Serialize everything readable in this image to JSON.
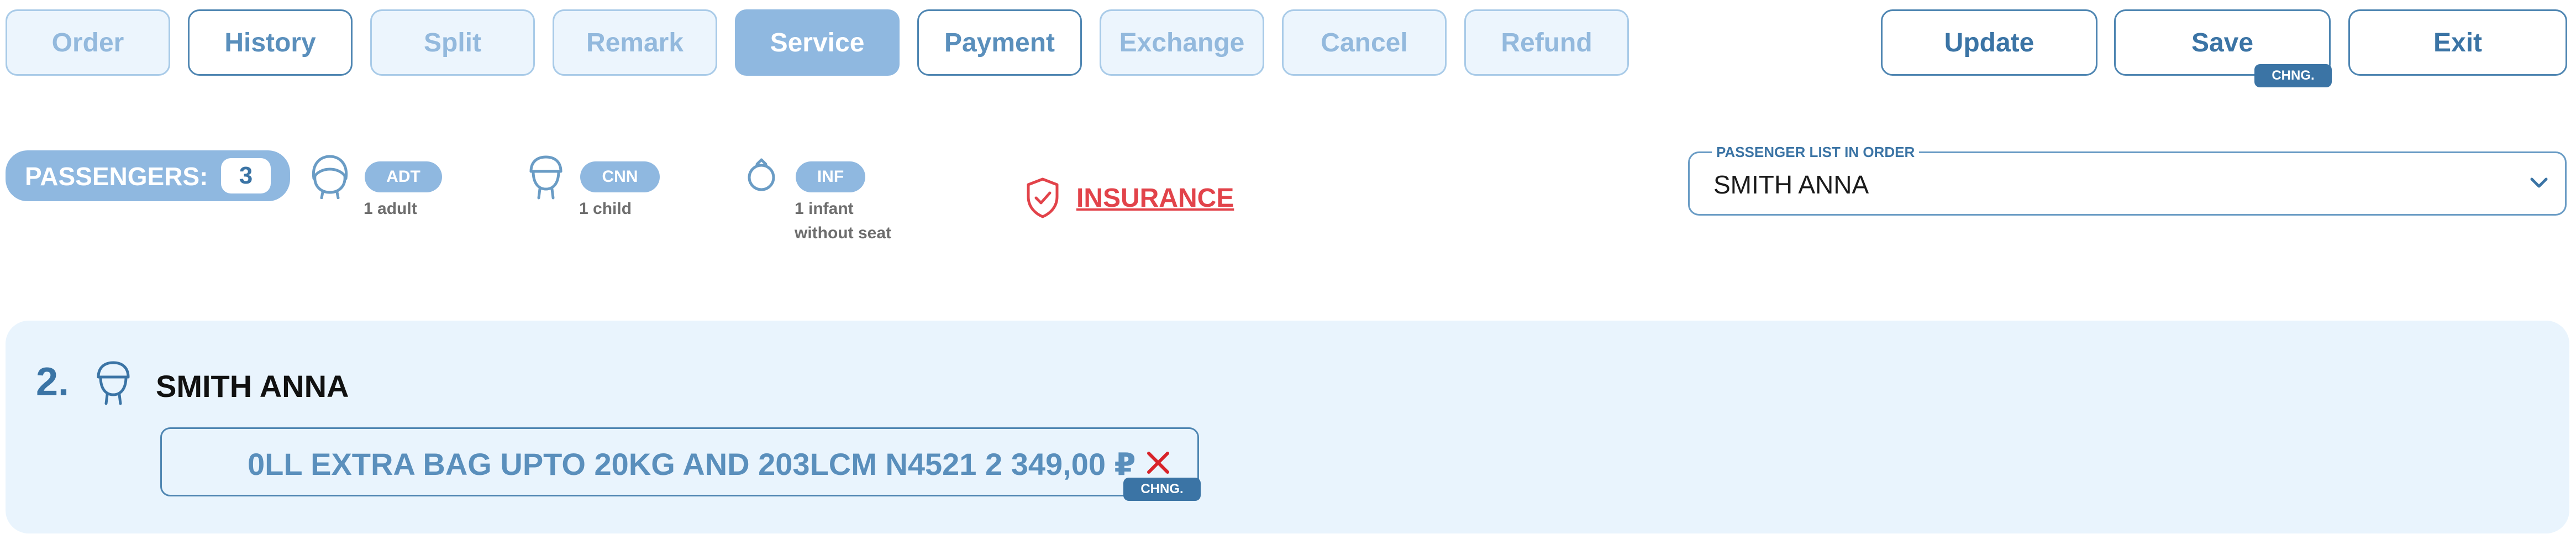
{
  "toolbar": {
    "tabs": [
      {
        "label": "Order",
        "state": "dim"
      },
      {
        "label": "History",
        "state": "normal"
      },
      {
        "label": "Split",
        "state": "dim"
      },
      {
        "label": "Remark",
        "state": "dim"
      },
      {
        "label": "Service",
        "state": "active"
      },
      {
        "label": "Payment",
        "state": "normal"
      },
      {
        "label": "Exchange",
        "state": "dim"
      },
      {
        "label": "Cancel",
        "state": "dim"
      },
      {
        "label": "Refund",
        "state": "dim"
      }
    ],
    "update_label": "Update",
    "save_label": "Save",
    "save_badge": "CHNG.",
    "exit_label": "Exit"
  },
  "passengers": {
    "label": "PASSENGERS:",
    "count": "3",
    "types": [
      {
        "code": "ADT",
        "description": "1 adult",
        "icon": "adult-icon"
      },
      {
        "code": "CNN",
        "description": "1 child",
        "icon": "child-icon"
      },
      {
        "code": "INF",
        "description": "1 infant without seat",
        "description_line1": "1 infant",
        "description_line2": "without seat",
        "icon": "infant-icon"
      }
    ],
    "insurance_label": "INSURANCE"
  },
  "passenger_select": {
    "label": "PASSENGER LIST IN ORDER",
    "value": "SMITH ANNA"
  },
  "passenger_card": {
    "number": "2.",
    "name": "SMITH ANNA",
    "service_text": "0LL EXTRA BAG UPTO 20KG AND 203LCM N4521 2 349,00 ₽",
    "service_badge": "CHNG."
  },
  "colors": {
    "accent": "#3b74a5",
    "active_tab": "#8fb8e0",
    "panel_bg": "#e9f4fd",
    "insurance_red": "#e2434a",
    "remove_red": "#d8232a"
  }
}
